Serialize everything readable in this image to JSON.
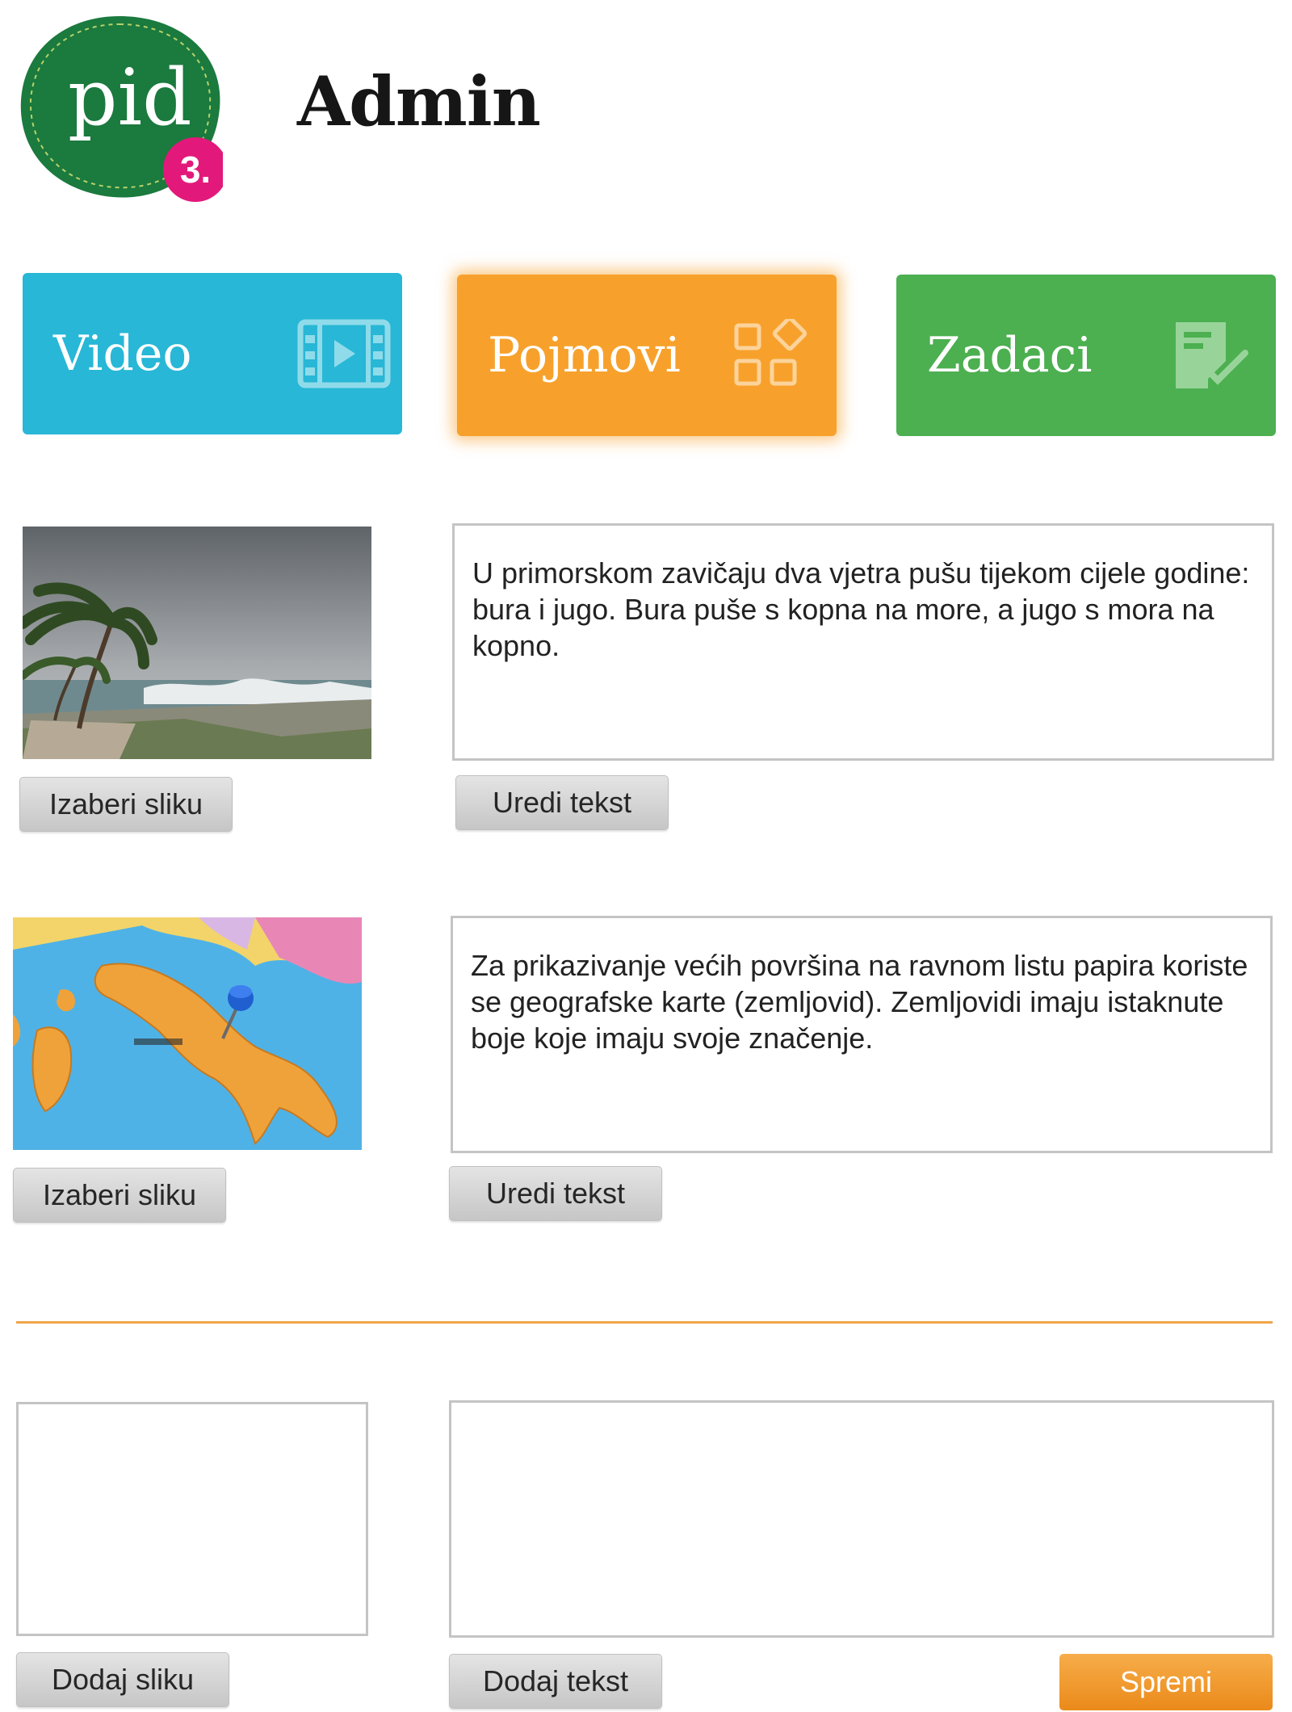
{
  "header": {
    "logo_text": "pid",
    "logo_grade": "3.",
    "title": "Admin"
  },
  "tabs": [
    {
      "label": "Video",
      "icon": "film-icon",
      "color": "#28b7d6"
    },
    {
      "label": "Pojmovi",
      "icon": "shapes-grid-icon",
      "color": "#f7a12c",
      "active": true
    },
    {
      "label": "Zadaci",
      "icon": "checklist-icon",
      "color": "#4caf50"
    }
  ],
  "entries": [
    {
      "image": "windy-beach-palm-trees",
      "text": "U primorskom zavičaju dva vjetra pušu tijekom cijele godine: bura i jugo. Bura puše s kopna na more, a jugo s mora na kopno.",
      "image_button": "Izaberi sliku",
      "text_button": "Uredi tekst"
    },
    {
      "image": "map-of-italy-with-pin",
      "text": "Za prikazivanje većih površina na ravnom listu papira koriste se geografske karte (zemljovid). Zemljovidi imaju istaknute boje koje imaju svoje značenje.",
      "image_button": "Izaberi sliku",
      "text_button": "Uredi tekst"
    }
  ],
  "new_entry": {
    "add_image_button": "Dodaj sliku",
    "add_text_button": "Dodaj tekst",
    "save_button": "Spremi"
  },
  "colors": {
    "accent_orange": "#f7a12c",
    "divider": "#f0a64a",
    "logo_green": "#1b7a3e",
    "logo_badge": "#e2197a"
  }
}
